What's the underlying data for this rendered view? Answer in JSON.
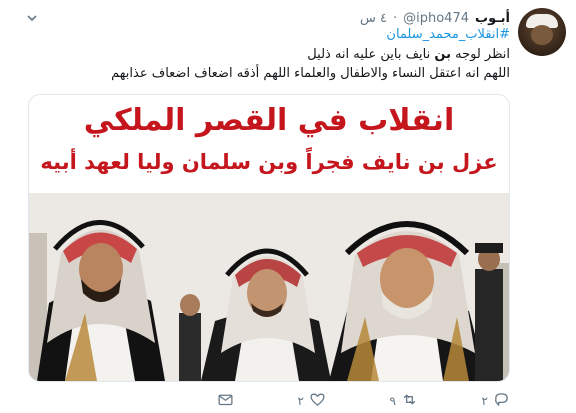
{
  "tweet": {
    "display_name": "أبـوب",
    "handle": "@ipho474",
    "separator": "·",
    "time": "٤ س",
    "hashtag": "#انقلاب_محمد_سلمان",
    "line1_before": "انظر لوجه ",
    "line1_bold": "بن",
    "line1_after": " نايف باين عليه انه ذليل",
    "line2": "اللهم انه اعتقل النساء والاطفال والعلماء اللهم أذقه اضعاف اضعاف عذابهم"
  },
  "media": {
    "title": "انقلاب في القصر الملكي",
    "subtitle": "عزل بن نايف فجراً وبن سلمان وليا لعهد أبيه"
  },
  "actions": {
    "reply_count": "٢",
    "retweet_count": "٩",
    "like_count": "٢",
    "icons": [
      "reply-icon",
      "retweet-icon",
      "like-icon",
      "message-icon"
    ]
  },
  "colors": {
    "link": "#1b95e0",
    "title_red": "#c4161c",
    "muted": "#657786"
  }
}
